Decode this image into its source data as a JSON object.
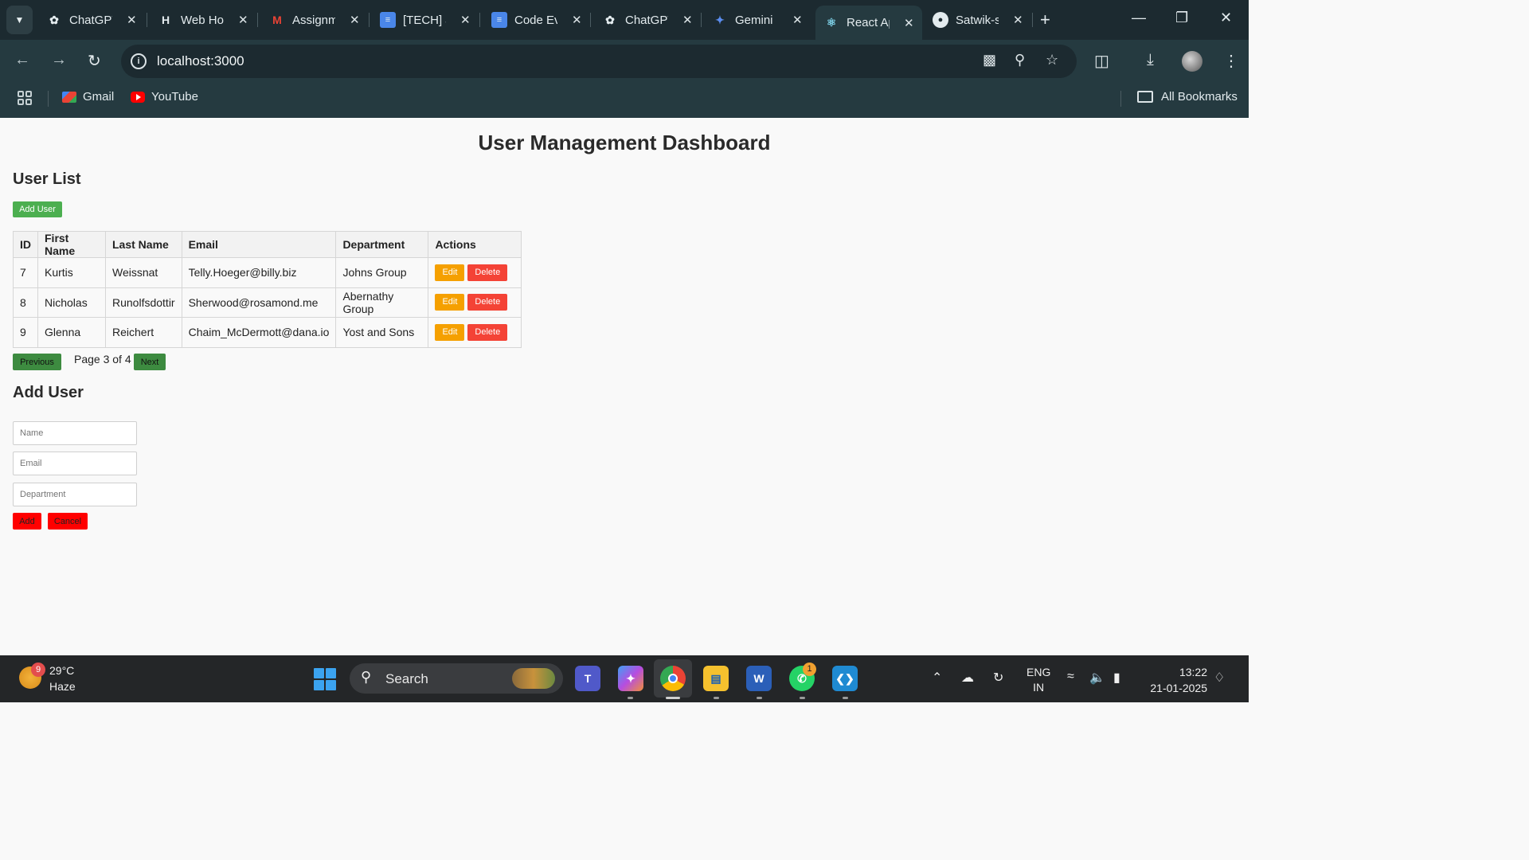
{
  "browser": {
    "tabs": [
      {
        "label": "ChatGPT",
        "icon": "openai-icon"
      },
      {
        "label": "Web Hosting",
        "icon": "hostinger-icon"
      },
      {
        "label": "Assignment",
        "icon": "gmail-icon"
      },
      {
        "label": "[TECH] J",
        "icon": "docs-icon"
      },
      {
        "label": "Code Ev",
        "icon": "docs-icon"
      },
      {
        "label": "ChatGPT",
        "icon": "openai-icon"
      },
      {
        "label": "Gemini",
        "icon": "gemini-icon"
      },
      {
        "label": "React App",
        "icon": "react-icon",
        "active": true
      },
      {
        "label": "Satwik-s",
        "icon": "github-icon"
      }
    ],
    "address": "localhost:3000",
    "bookmarks": [
      {
        "label": "Gmail"
      },
      {
        "label": "YouTube"
      }
    ],
    "all_bookmarks": "All Bookmarks"
  },
  "page": {
    "title": "User Management Dashboard",
    "user_list": {
      "heading": "User List",
      "add_button": "Add User",
      "columns": [
        "ID",
        "First Name",
        "Last Name",
        "Email",
        "Department",
        "Actions"
      ],
      "rows": [
        {
          "id": "7",
          "first": "Kurtis",
          "last": "Weissnat",
          "email": "Telly.Hoeger@billy.biz",
          "dept": "Johns Group"
        },
        {
          "id": "8",
          "first": "Nicholas",
          "last": "Runolfsdottir",
          "email": "Sherwood@rosamond.me",
          "dept": "Abernathy Group"
        },
        {
          "id": "9",
          "first": "Glenna",
          "last": "Reichert",
          "email": "Chaim_McDermott@dana.io",
          "dept": "Yost and Sons"
        }
      ],
      "edit_label": "Edit",
      "delete_label": "Delete",
      "pager": {
        "prev": "Previous",
        "status": "Page 3 of 4",
        "next": "Next"
      }
    },
    "add_user": {
      "heading": "Add User",
      "name_placeholder": "Name",
      "email_placeholder": "Email",
      "dept_placeholder": "Department",
      "add_label": "Add",
      "cancel_label": "Cancel"
    }
  },
  "taskbar": {
    "weather": {
      "temp": "29°C",
      "desc": "Haze",
      "badge": "9"
    },
    "search_label": "Search",
    "whatsapp_badge": "1",
    "lang": {
      "line1": "ENG",
      "line2": "IN"
    },
    "time": "13:22",
    "date": "21-01-2025"
  },
  "colors": {
    "chrome_dark": "#1c2a30",
    "chrome_mid": "#253a40",
    "green": "#4caf50",
    "orange": "#f5a000",
    "red": "#f44336",
    "pure_red": "#ff0000"
  }
}
